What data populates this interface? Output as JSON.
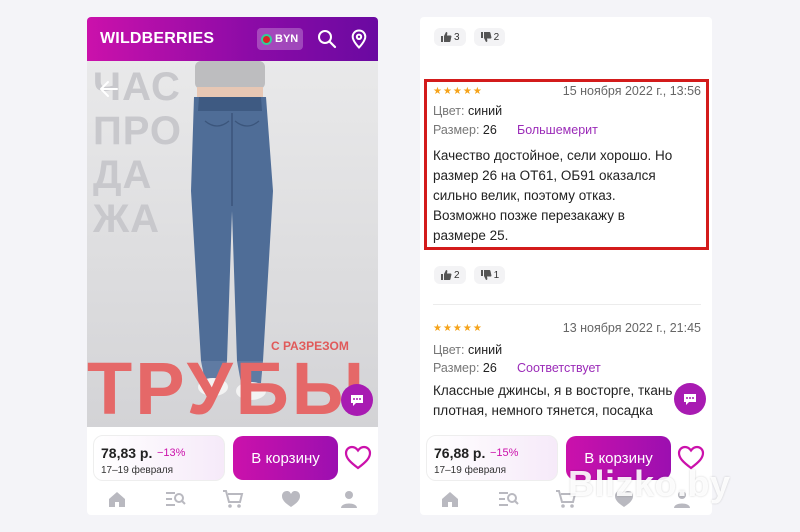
{
  "left": {
    "header": {
      "logo": "WILDBERRIES",
      "currency": "BYN"
    },
    "photo": {
      "watermark_lines": [
        "ЧАС",
        "ПРО",
        "ДА",
        "ЖА"
      ],
      "caption": "С РАЗРЕЗОМ",
      "headline": "ТРУБЫ"
    },
    "buybar": {
      "price": "78,83 р.",
      "discount": "−13%",
      "delivery": "17–19 февраля",
      "cart_label": "В корзину"
    }
  },
  "right": {
    "top_votes": {
      "likes": "3",
      "dislikes": "2"
    },
    "reviews": [
      {
        "rating": 5,
        "date": "15 ноября 2022 г., 13:56",
        "color_label": "Цвет:",
        "color_value": "синий",
        "size_label": "Размер:",
        "size_value": "26",
        "fit": "Большемерит",
        "text_lines": [
          "Качество достойное, сели хорошо. Но",
          "размер 26 на ОТ61, ОБ91 оказался",
          "сильно велик, поэтому отказ.",
          "Возможно позже перезакажу в",
          "размере 25."
        ],
        "likes": "2",
        "dislikes": "1"
      },
      {
        "rating": 5,
        "date": "13 ноября 2022 г., 21:45",
        "color_label": "Цвет:",
        "color_value": "синий",
        "size_label": "Размер:",
        "size_value": "26",
        "fit": "Соответствует",
        "text_lines": [
          "Классные джинсы, я в восторге, ткань",
          "плотная, немного тянется, посадка"
        ]
      }
    ],
    "buybar": {
      "price": "76,88 р.",
      "discount": "−15%",
      "delivery": "17–19 февраля",
      "cart_label": "В корзину"
    }
  },
  "watermark": "Blizko.by",
  "colors": {
    "brand": "#cb11ab",
    "brand_dark": "#6a09a1",
    "highlight": "#d31b1b",
    "stars": "#f5a31a"
  }
}
